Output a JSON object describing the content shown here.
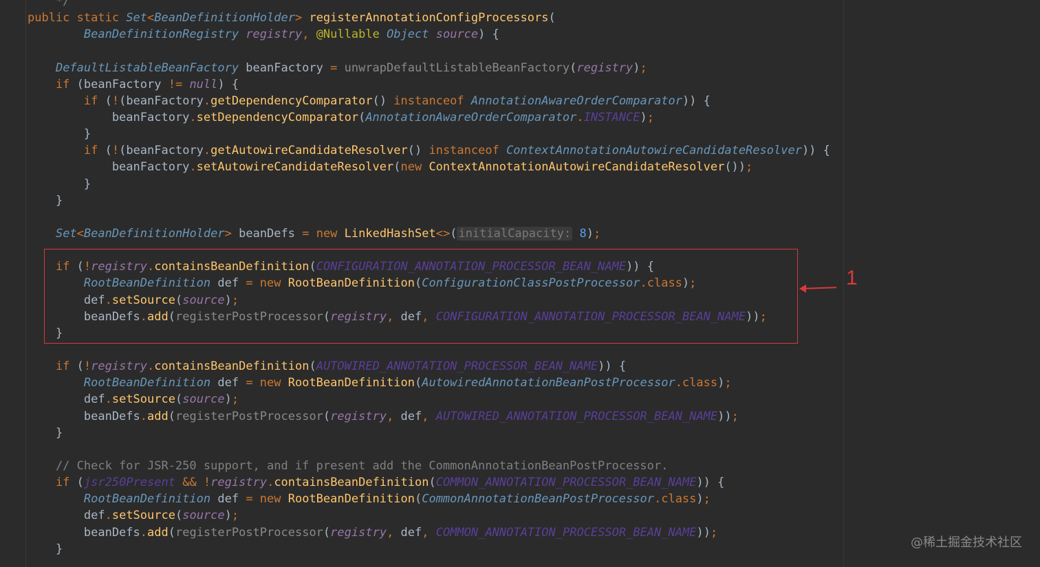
{
  "code_lines": [
    [
      {
        "c": "cm",
        "t": "    */"
      }
    ],
    [
      {
        "c": "kw",
        "t": "public static "
      },
      {
        "c": "ty",
        "t": "Set"
      },
      {
        "c": "kw",
        "t": "<"
      },
      {
        "c": "ty",
        "t": "BeanDefinitionHolder"
      },
      {
        "c": "kw",
        "t": "> "
      },
      {
        "c": "fn",
        "t": "registerAnnotationConfigProcessors"
      },
      {
        "c": "pl",
        "t": "("
      }
    ],
    [
      {
        "c": "pl",
        "t": "        "
      },
      {
        "c": "ty",
        "t": "BeanDefinitionRegistry"
      },
      {
        "c": "pl",
        "t": " "
      },
      {
        "c": "it",
        "t": "registry"
      },
      {
        "c": "kw",
        "t": ", "
      },
      {
        "c": "an",
        "t": "@Nullable"
      },
      {
        "c": "pl",
        "t": " "
      },
      {
        "c": "ty",
        "t": "Object"
      },
      {
        "c": "pl",
        "t": " "
      },
      {
        "c": "it",
        "t": "source"
      },
      {
        "c": "pl",
        "t": ") {"
      }
    ],
    [],
    [
      {
        "c": "pl",
        "t": "    "
      },
      {
        "c": "ty",
        "t": "DefaultListableBeanFactory"
      },
      {
        "c": "pl",
        "t": " beanFactory "
      },
      {
        "c": "kw",
        "t": "= "
      },
      {
        "c": "un",
        "t": "unwrapDefaultListableBeanFactory"
      },
      {
        "c": "pl",
        "t": "("
      },
      {
        "c": "it",
        "t": "registry"
      },
      {
        "c": "pl",
        "t": ")"
      },
      {
        "c": "kw",
        "t": ";"
      }
    ],
    [
      {
        "c": "kw",
        "t": "    if "
      },
      {
        "c": "pl",
        "t": "(beanFactory "
      },
      {
        "c": "kw",
        "t": "!= "
      },
      {
        "c": "it",
        "t": "null"
      },
      {
        "c": "pl",
        "t": ") {"
      }
    ],
    [
      {
        "c": "kw",
        "t": "        if "
      },
      {
        "c": "pl",
        "t": "("
      },
      {
        "c": "kw",
        "t": "!"
      },
      {
        "c": "pl",
        "t": "(beanFactory"
      },
      {
        "c": "kw",
        "t": "."
      },
      {
        "c": "mg",
        "t": "getDependencyComparator"
      },
      {
        "c": "pl",
        "t": "() "
      },
      {
        "c": "kw",
        "t": "instanceof "
      },
      {
        "c": "ty",
        "t": "AnnotationAwareOrderComparator"
      },
      {
        "c": "pl",
        "t": ")) {"
      }
    ],
    [
      {
        "c": "pl",
        "t": "            beanFactory"
      },
      {
        "c": "kw",
        "t": "."
      },
      {
        "c": "mg",
        "t": "setDependencyComparator"
      },
      {
        "c": "pl",
        "t": "("
      },
      {
        "c": "ty",
        "t": "AnnotationAwareOrderComparator"
      },
      {
        "c": "kw",
        "t": "."
      },
      {
        "c": "cs",
        "t": "INSTANCE"
      },
      {
        "c": "pl",
        "t": ")"
      },
      {
        "c": "kw",
        "t": ";"
      }
    ],
    [
      {
        "c": "pl",
        "t": "        }"
      }
    ],
    [
      {
        "c": "kw",
        "t": "        if "
      },
      {
        "c": "pl",
        "t": "("
      },
      {
        "c": "kw",
        "t": "!"
      },
      {
        "c": "pl",
        "t": "(beanFactory"
      },
      {
        "c": "kw",
        "t": "."
      },
      {
        "c": "mg",
        "t": "getAutowireCandidateResolver"
      },
      {
        "c": "pl",
        "t": "() "
      },
      {
        "c": "kw",
        "t": "instanceof "
      },
      {
        "c": "ty",
        "t": "ContextAnnotationAutowireCandidateResolver"
      },
      {
        "c": "pl",
        "t": ")) {"
      }
    ],
    [
      {
        "c": "pl",
        "t": "            beanFactory"
      },
      {
        "c": "kw",
        "t": "."
      },
      {
        "c": "mg",
        "t": "setAutowireCandidateResolver"
      },
      {
        "c": "pl",
        "t": "("
      },
      {
        "c": "kw",
        "t": "new "
      },
      {
        "c": "fn",
        "t": "ContextAnnotationAutowireCandidateResolver"
      },
      {
        "c": "pl",
        "t": "())"
      },
      {
        "c": "kw",
        "t": ";"
      }
    ],
    [
      {
        "c": "pl",
        "t": "        }"
      }
    ],
    [
      {
        "c": "pl",
        "t": "    }"
      }
    ],
    [],
    [
      {
        "c": "pl",
        "t": "    "
      },
      {
        "c": "ty",
        "t": "Set"
      },
      {
        "c": "kw",
        "t": "<"
      },
      {
        "c": "ty",
        "t": "BeanDefinitionHolder"
      },
      {
        "c": "kw",
        "t": "> "
      },
      {
        "c": "pl",
        "t": "beanDefs "
      },
      {
        "c": "kw",
        "t": "= new "
      },
      {
        "c": "fn",
        "t": "LinkedHashSet"
      },
      {
        "c": "kw",
        "t": "<>"
      },
      {
        "c": "pl",
        "t": "("
      },
      {
        "c": "hint",
        "t": "initialCapacity:"
      },
      {
        "c": "ac",
        "t": " 8"
      },
      {
        "c": "pl",
        "t": ")"
      },
      {
        "c": "kw",
        "t": ";"
      }
    ],
    [],
    [
      {
        "c": "kw",
        "t": "    if "
      },
      {
        "c": "pl",
        "t": "("
      },
      {
        "c": "kw",
        "t": "!"
      },
      {
        "c": "it",
        "t": "registry"
      },
      {
        "c": "kw",
        "t": "."
      },
      {
        "c": "mg",
        "t": "containsBeanDefinition"
      },
      {
        "c": "pl",
        "t": "("
      },
      {
        "c": "cs",
        "t": "CONFIGURATION_ANNOTATION_PROCESSOR_BEAN_NAME"
      },
      {
        "c": "pl",
        "t": ")) {"
      }
    ],
    [
      {
        "c": "pl",
        "t": "        "
      },
      {
        "c": "ty",
        "t": "RootBeanDefinition"
      },
      {
        "c": "pl",
        "t": " def "
      },
      {
        "c": "kw",
        "t": "= new "
      },
      {
        "c": "fn",
        "t": "RootBeanDefinition"
      },
      {
        "c": "pl",
        "t": "("
      },
      {
        "c": "ty",
        "t": "ConfigurationClassPostProcessor"
      },
      {
        "c": "kw",
        "t": ".class"
      },
      {
        "c": "pl",
        "t": ")"
      },
      {
        "c": "kw",
        "t": ";"
      }
    ],
    [
      {
        "c": "pl",
        "t": "        def"
      },
      {
        "c": "kw",
        "t": "."
      },
      {
        "c": "mg",
        "t": "setSource"
      },
      {
        "c": "pl",
        "t": "("
      },
      {
        "c": "it",
        "t": "source"
      },
      {
        "c": "pl",
        "t": ")"
      },
      {
        "c": "kw",
        "t": ";"
      }
    ],
    [
      {
        "c": "pl",
        "t": "        beanDefs"
      },
      {
        "c": "kw",
        "t": "."
      },
      {
        "c": "mg",
        "t": "add"
      },
      {
        "c": "pl",
        "t": "("
      },
      {
        "c": "un",
        "t": "registerPostProcessor"
      },
      {
        "c": "pl",
        "t": "("
      },
      {
        "c": "it",
        "t": "registry"
      },
      {
        "c": "kw",
        "t": ", "
      },
      {
        "c": "pl",
        "t": "def"
      },
      {
        "c": "kw",
        "t": ", "
      },
      {
        "c": "cs",
        "t": "CONFIGURATION_ANNOTATION_PROCESSOR_BEAN_NAME"
      },
      {
        "c": "pl",
        "t": "))"
      },
      {
        "c": "kw",
        "t": ";"
      }
    ],
    [
      {
        "c": "pl",
        "t": "    }"
      }
    ],
    [],
    [
      {
        "c": "kw",
        "t": "    if "
      },
      {
        "c": "pl",
        "t": "("
      },
      {
        "c": "kw",
        "t": "!"
      },
      {
        "c": "it",
        "t": "registry"
      },
      {
        "c": "kw",
        "t": "."
      },
      {
        "c": "mg",
        "t": "containsBeanDefinition"
      },
      {
        "c": "pl",
        "t": "("
      },
      {
        "c": "cs",
        "t": "AUTOWIRED_ANNOTATION_PROCESSOR_BEAN_NAME"
      },
      {
        "c": "pl",
        "t": ")) {"
      }
    ],
    [
      {
        "c": "pl",
        "t": "        "
      },
      {
        "c": "ty",
        "t": "RootBeanDefinition"
      },
      {
        "c": "pl",
        "t": " def "
      },
      {
        "c": "kw",
        "t": "= new "
      },
      {
        "c": "fn",
        "t": "RootBeanDefinition"
      },
      {
        "c": "pl",
        "t": "("
      },
      {
        "c": "ty",
        "t": "AutowiredAnnotationBeanPostProcessor"
      },
      {
        "c": "kw",
        "t": ".class"
      },
      {
        "c": "pl",
        "t": ")"
      },
      {
        "c": "kw",
        "t": ";"
      }
    ],
    [
      {
        "c": "pl",
        "t": "        def"
      },
      {
        "c": "kw",
        "t": "."
      },
      {
        "c": "mg",
        "t": "setSource"
      },
      {
        "c": "pl",
        "t": "("
      },
      {
        "c": "it",
        "t": "source"
      },
      {
        "c": "pl",
        "t": ")"
      },
      {
        "c": "kw",
        "t": ";"
      }
    ],
    [
      {
        "c": "pl",
        "t": "        beanDefs"
      },
      {
        "c": "kw",
        "t": "."
      },
      {
        "c": "mg",
        "t": "add"
      },
      {
        "c": "pl",
        "t": "("
      },
      {
        "c": "un",
        "t": "registerPostProcessor"
      },
      {
        "c": "pl",
        "t": "("
      },
      {
        "c": "it",
        "t": "registry"
      },
      {
        "c": "kw",
        "t": ", "
      },
      {
        "c": "pl",
        "t": "def"
      },
      {
        "c": "kw",
        "t": ", "
      },
      {
        "c": "cs",
        "t": "AUTOWIRED_ANNOTATION_PROCESSOR_BEAN_NAME"
      },
      {
        "c": "pl",
        "t": "))"
      },
      {
        "c": "kw",
        "t": ";"
      }
    ],
    [
      {
        "c": "pl",
        "t": "    }"
      }
    ],
    [],
    [
      {
        "c": "cm",
        "t": "    // Check for JSR-250 support, and if present add the CommonAnnotationBeanPostProcessor."
      }
    ],
    [
      {
        "c": "kw",
        "t": "    if "
      },
      {
        "c": "pl",
        "t": "("
      },
      {
        "c": "cs",
        "t": "jsr250Present"
      },
      {
        "c": "pl",
        "t": " "
      },
      {
        "c": "kw",
        "t": "&& !"
      },
      {
        "c": "it",
        "t": "registry"
      },
      {
        "c": "kw",
        "t": "."
      },
      {
        "c": "mg",
        "t": "containsBeanDefinition"
      },
      {
        "c": "pl",
        "t": "("
      },
      {
        "c": "cs",
        "t": "COMMON_ANNOTATION_PROCESSOR_BEAN_NAME"
      },
      {
        "c": "pl",
        "t": ")) {"
      }
    ],
    [
      {
        "c": "pl",
        "t": "        "
      },
      {
        "c": "ty",
        "t": "RootBeanDefinition"
      },
      {
        "c": "pl",
        "t": " def "
      },
      {
        "c": "kw",
        "t": "= new "
      },
      {
        "c": "fn",
        "t": "RootBeanDefinition"
      },
      {
        "c": "pl",
        "t": "("
      },
      {
        "c": "ty",
        "t": "CommonAnnotationBeanPostProcessor"
      },
      {
        "c": "kw",
        "t": ".class"
      },
      {
        "c": "pl",
        "t": ")"
      },
      {
        "c": "kw",
        "t": ";"
      }
    ],
    [
      {
        "c": "pl",
        "t": "        def"
      },
      {
        "c": "kw",
        "t": "."
      },
      {
        "c": "mg",
        "t": "setSource"
      },
      {
        "c": "pl",
        "t": "("
      },
      {
        "c": "it",
        "t": "source"
      },
      {
        "c": "pl",
        "t": ")"
      },
      {
        "c": "kw",
        "t": ";"
      }
    ],
    [
      {
        "c": "pl",
        "t": "        beanDefs"
      },
      {
        "c": "kw",
        "t": "."
      },
      {
        "c": "mg",
        "t": "add"
      },
      {
        "c": "pl",
        "t": "("
      },
      {
        "c": "un",
        "t": "registerPostProcessor"
      },
      {
        "c": "pl",
        "t": "("
      },
      {
        "c": "it",
        "t": "registry"
      },
      {
        "c": "kw",
        "t": ", "
      },
      {
        "c": "pl",
        "t": "def"
      },
      {
        "c": "kw",
        "t": ", "
      },
      {
        "c": "cs",
        "t": "COMMON_ANNOTATION_PROCESSOR_BEAN_NAME"
      },
      {
        "c": "pl",
        "t": "))"
      },
      {
        "c": "kw",
        "t": ";"
      }
    ],
    [
      {
        "c": "pl",
        "t": "    }"
      }
    ]
  ],
  "annotation": {
    "number": "1",
    "color": "#d93a3a"
  },
  "watermark": "@稀土掘金技术社区"
}
